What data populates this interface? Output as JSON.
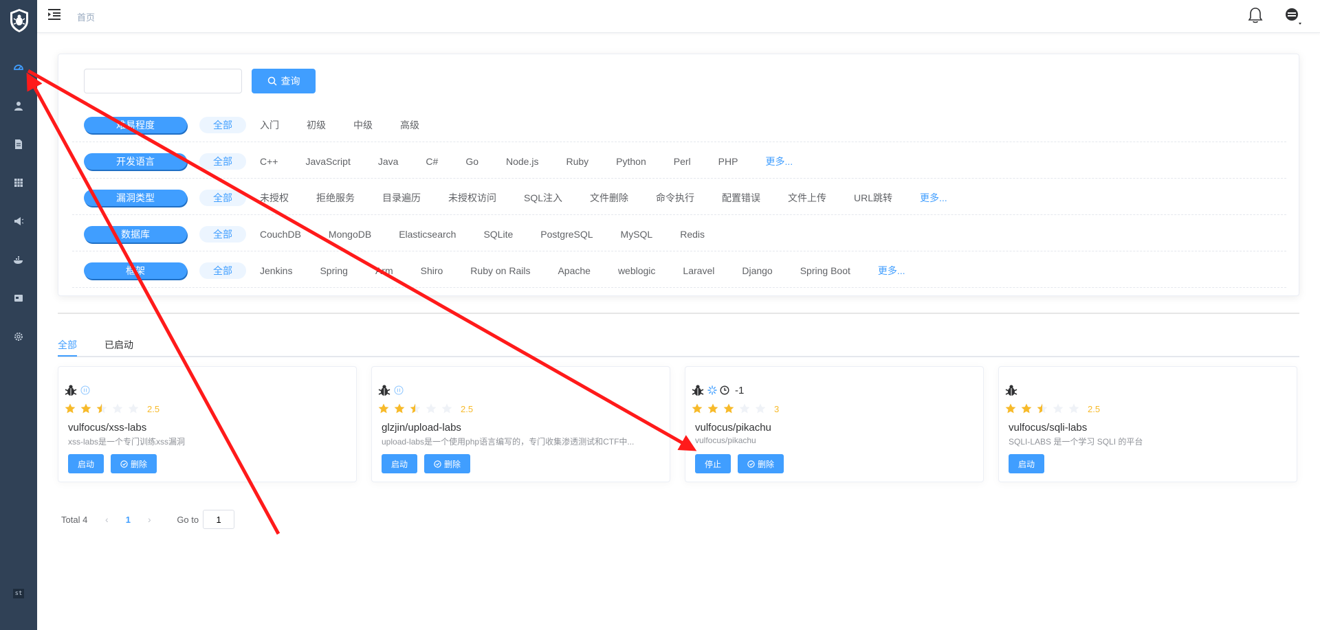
{
  "header": {
    "breadcrumb": "首页"
  },
  "sidebar": {
    "items": [
      {
        "icon": "dashboard-icon"
      },
      {
        "icon": "user-icon"
      },
      {
        "icon": "document-icon"
      },
      {
        "icon": "table-icon"
      },
      {
        "icon": "megaphone-icon"
      },
      {
        "icon": "docker-icon"
      },
      {
        "icon": "card-icon"
      },
      {
        "icon": "settings-icon"
      }
    ],
    "footer_badge": "st"
  },
  "search": {
    "value": "",
    "placeholder": "",
    "button_label": "查询"
  },
  "filters": [
    {
      "label": "难易程度",
      "options": [
        "全部",
        "入门",
        "初级",
        "中级",
        "高级"
      ],
      "more": ""
    },
    {
      "label": "开发语言",
      "options": [
        "全部",
        "C++",
        "JavaScript",
        "Java",
        "C#",
        "Go",
        "Node.js",
        "Ruby",
        "Python",
        "Perl",
        "PHP"
      ],
      "more": "更多..."
    },
    {
      "label": "漏洞类型",
      "options": [
        "全部",
        "未授权",
        "拒绝服务",
        "目录遍历",
        "未授权访问",
        "SQL注入",
        "文件删除",
        "命令执行",
        "配置错误",
        "文件上传",
        "URL跳转"
      ],
      "more": "更多..."
    },
    {
      "label": "数据库",
      "options": [
        "全部",
        "CouchDB",
        "MongoDB",
        "Elasticsearch",
        "SQLite",
        "PostgreSQL",
        "MySQL",
        "Redis"
      ],
      "more": ""
    },
    {
      "label": "框架",
      "options": [
        "全部",
        "Jenkins",
        "Spring",
        "Arm",
        "Shiro",
        "Ruby on Rails",
        "Apache",
        "weblogic",
        "Laravel",
        "Django",
        "Spring Boot"
      ],
      "more": "更多..."
    }
  ],
  "tabs": [
    {
      "label": "全部",
      "active": true
    },
    {
      "label": "已启动",
      "active": false
    }
  ],
  "cards": [
    {
      "name": "vulfocus/xss-labs",
      "desc": "xss-labs是一个专门训练xss漏洞",
      "rating": 2.5,
      "score": "2.5",
      "status": "paused-icon",
      "timer": "",
      "buttons": [
        {
          "label": "启动",
          "icon": ""
        },
        {
          "label": "删除",
          "icon": "delete-icon"
        }
      ]
    },
    {
      "name": "glzjin/upload-labs",
      "desc": "upload-labs是一个使用php语言编写的，专门收集渗透测试和CTF中...",
      "rating": 2.5,
      "score": "2.5",
      "status": "paused-icon",
      "timer": "",
      "buttons": [
        {
          "label": "启动",
          "icon": ""
        },
        {
          "label": "删除",
          "icon": "delete-icon"
        }
      ]
    },
    {
      "name": "vulfocus/pikachu",
      "desc": "vulfocus/pikachu",
      "rating": 3,
      "score": "3",
      "status": "running-icon",
      "timer": "-1",
      "buttons": [
        {
          "label": "停止",
          "icon": ""
        },
        {
          "label": "删除",
          "icon": "delete-icon"
        }
      ]
    },
    {
      "name": "vulfocus/sqli-labs",
      "desc": "SQLI-LABS 是一个学习 SQLI 的平台",
      "rating": 2.5,
      "score": "2.5",
      "status": "",
      "timer": "",
      "buttons": [
        {
          "label": "启动",
          "icon": ""
        }
      ]
    }
  ],
  "pagination": {
    "total": "Total 4",
    "prev": "‹",
    "current": "1",
    "next": "›",
    "goto_label": "Go to",
    "goto_value": "1"
  },
  "colors": {
    "primary": "#409eff",
    "sidebar": "#304156",
    "star": "#f7ba2a",
    "annotation": "#ff1a1a"
  }
}
